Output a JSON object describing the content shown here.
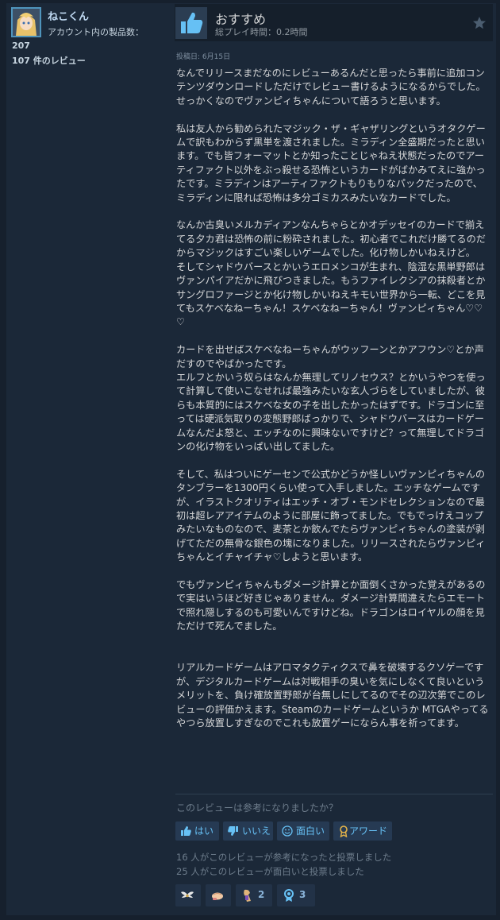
{
  "author": {
    "name": "ねこくん",
    "owned_label": "アカウント内の製品数：",
    "owned_count": "207",
    "review_count": "107 件のレビュー"
  },
  "review": {
    "recommendation": "おすすめ",
    "hours": "総プレイ時間：0.2時間",
    "posted": "投稿日: 6月15日",
    "body": "なんでリリースまだなのにレビューあるんだと思ったら事前に追加コンテンツダウンロードしただけでレビュー書けるようになるからでした。せっかくなのでヴァンピィちゃんについて語ろうと思います。\n\n私は友人から勧められたマジック・ザ・ギャザリングというオタクゲームで訳もわからず黒単を渡されました。ミラディン全盛期だったと思います。でも皆フォーマットとか知ったことじゃねえ状態だったのでアーティファクト以外をぶっ殺せる恐怖というカードがばかみてえに強かったです。ミラディンはアーティファクトもりもりなパックだったので、ミラディンに限れば恐怖は多分ゴミカスみたいなカードでした。\n\nなんか古臭いメルカディアンなんちゃらとかオデッセイのカードで揃えてる夕カ君は恐怖の前に粉砕されました。初心者でこれだけ勝てるのだからマジックはすごい楽しいゲームでした。化け物しかいねえけど。\nそしてシャドウバースとかいうエロメンコが生まれ、陰湿な黒単野郎はヴァンパイアだかに飛びつきました。もうファイレクシアの抹殺者とかサングロファージとか化け物しかいねえキモい世界から一転、どこを見てもスケベなねーちゃん！スケベなねーちゃん！ヴァンピィちゃん♡♡♡\n\nカードを出せばスケベなねーちゃんがウッフーンとかアフウン♡とか声だすのでやばかったです。\nエルフとかいう奴らはなんか無理してリノセウス？とかいうやつを使って計算して使いこなせれば最強みたいな玄人づらをしていましたが、彼らも本質的にはスケベな女の子を出したかったはずです。ドラゴンに至っては硬派気取りの変態野郎ばっかりで、シャドウバースはカードゲームなんだよ怒と、エッチなのに興味ないですけど？って無理してドラゴンの化け物をいっぱい出してました。\n\nそして、私はついにゲーセンで公式かどうか怪しいヴァンピィちゃんのタンブラーを1300円くらい使って入手しました。エッチなゲームですが、イラストクオリティはエッチ・オブ・モンドセレクションなので最初は超レアアイテムのように部屋に飾ってました。でもでっけえコップみたいなものなので、麦茶とか飲んでたらヴァンピィちゃんの塗装が剥げてただの無骨な銀色の塊になりました。リリースされたらヴァンピィちゃんとイチャイチャ♡しようと思います。\n\nでもヴァンピィちゃんもダメージ計算とか面倒くさかった覚えがあるので実はいうほど好きじゃありません。ダメージ計算間違えたらエモートで照れ隠しするのも可愛いんですけどね。ドラゴンはロイヤルの顔を見ただけで死んでました。\n\n\nリアルカードゲームはアロマタクティクスで鼻を破壊するクソゲーですが、デジタルカードゲームは対戦相手の臭いを気にしなくて良いというメリットを、負け確放置野郎が台無しにしてるのでその辺次第でこのレビューの評価かえます。Steamのカードゲームというか MTGAやってるやつら放置しすぎなのでこれも放置ゲーにならん事を祈ってます。"
  },
  "feedback": {
    "question": "このレビューは参考になりましたか？",
    "yes": "はい",
    "no": "いいえ",
    "funny": "面白い",
    "award": "アワード",
    "helpful_stat": "16 人がこのレビューが参考になったと投票しました",
    "funny_stat": "25 人がこのレビューが面白いと投票しました"
  },
  "awards": [
    {
      "icon": "wings-icon",
      "count": ""
    },
    {
      "icon": "hand-icon",
      "count": ""
    },
    {
      "icon": "figure-icon",
      "count": "2"
    },
    {
      "icon": "medal-icon",
      "count": "3"
    }
  ],
  "colors": {
    "background": "#16202d",
    "panel": "#1b2838",
    "link": "#67c1f5",
    "thumb_up": "#66c0f4"
  }
}
